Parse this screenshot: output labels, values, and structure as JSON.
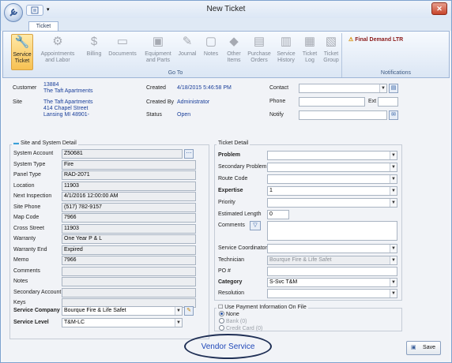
{
  "window": {
    "title": "New Ticket",
    "close": "✕"
  },
  "qat": {
    "dropdown": "▾"
  },
  "tabs": [
    {
      "label": "Ticket"
    }
  ],
  "ribbon": {
    "buttons": [
      {
        "label": "Service Ticket",
        "icon": "wrench-icon",
        "glyph": "🔧",
        "active": true
      },
      {
        "label": "Appointments and Labor",
        "icon": "gear-icon",
        "glyph": "⚙"
      },
      {
        "label": "Billing",
        "icon": "dollar-icon",
        "glyph": "$"
      },
      {
        "label": "Documents",
        "icon": "documents-icon",
        "glyph": "▭"
      },
      {
        "label": "Equipment and Parts",
        "icon": "equipment-icon",
        "glyph": "▣"
      },
      {
        "label": "Journal",
        "icon": "journal-icon",
        "glyph": "✎"
      },
      {
        "label": "Notes",
        "icon": "notes-icon",
        "glyph": "▢"
      },
      {
        "label": "Other Items",
        "icon": "tag-icon",
        "glyph": "◆"
      },
      {
        "label": "Purchase Orders",
        "icon": "purchase-orders-icon",
        "glyph": "▤"
      },
      {
        "label": "Service History",
        "icon": "history-icon",
        "glyph": "▥"
      },
      {
        "label": "Ticket Log",
        "icon": "log-icon",
        "glyph": "▦"
      },
      {
        "label": "Ticket Group",
        "icon": "group-icon",
        "glyph": "▧"
      }
    ],
    "group_goto": "Go To",
    "group_notifications": "Notifications",
    "notification": "Final Demand LTR"
  },
  "header": {
    "customer_label": "Customer",
    "customer_id": "13884",
    "customer_name": "The Taft Apartments",
    "site_label": "Site",
    "site_name": "The Taft Apartments",
    "site_addr1": "414 Chapel Street",
    "site_addr2": "Lansing MI 48901-",
    "created_label": "Created",
    "created_value": "4/18/2015 5:46:58 PM",
    "created_by_label": "Created By",
    "created_by_value": "Administrator",
    "status_label": "Status",
    "status_value": "Open",
    "contact_label": "Contact",
    "phone_label": "Phone",
    "ext_label": "Ext",
    "notify_label": "Notify"
  },
  "site_detail": {
    "title": "Site and System Detail",
    "rows": [
      {
        "label": "System Account",
        "value": "Z50681"
      },
      {
        "label": "System Type",
        "value": "Fire"
      },
      {
        "label": "Panel Type",
        "value": "RAD-2071"
      },
      {
        "label": "Location",
        "value": "11903"
      },
      {
        "label": "Next Inspection",
        "value": "4/1/2016 12:00:00 AM"
      },
      {
        "label": "Site Phone",
        "value": "(517) 782-9157"
      },
      {
        "label": "Map Code",
        "value": "7966"
      },
      {
        "label": "Cross Street",
        "value": "11903"
      },
      {
        "label": "Warranty",
        "value": "One Year P & L"
      },
      {
        "label": "Warranty End",
        "value": "Expired"
      },
      {
        "label": "Memo",
        "value": "7966"
      },
      {
        "label": "Comments",
        "value": ""
      },
      {
        "label": "Notes",
        "value": ""
      },
      {
        "label": "Secondary Account",
        "value": ""
      },
      {
        "label": "Keys",
        "value": ""
      }
    ],
    "service_company_label": "Service Company",
    "service_company_value": "Bourque Fire & Life Safet",
    "service_level_label": "Service Level",
    "service_level_value": "T&M-LC"
  },
  "ticket_detail": {
    "title": "Ticket Detail",
    "problem": "Problem",
    "secondary_problem": "Secondary Problem",
    "route_code": "Route Code",
    "expertise": "Expertise",
    "expertise_value": "1",
    "priority": "Priority",
    "estimated_length": "Estimated Length",
    "estimated_length_value": "0",
    "comments": "Comments",
    "service_coordinator": "Service Coordinator",
    "technician": "Technician",
    "technician_value": "Bourque Fire & Life Safet",
    "po": "PO #",
    "category": "Category",
    "category_value": "S-Svc T&M",
    "resolution": "Resolution"
  },
  "payment": {
    "label": "Use Payment Information On File",
    "options": [
      {
        "label": "None"
      },
      {
        "label": "Bank (0)"
      },
      {
        "label": "Credit Card (0)"
      }
    ]
  },
  "footer": {
    "vendor_service": "Vendor Service",
    "save": "Save"
  }
}
